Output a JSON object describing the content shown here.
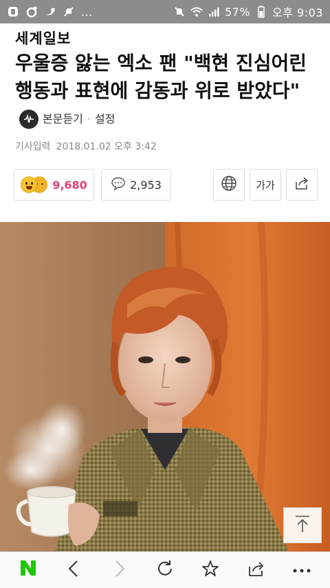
{
  "status_bar": {
    "ellipsis": "...",
    "battery_percent": "57%",
    "time": "오후 9:03"
  },
  "article": {
    "publisher": "세계일보",
    "title": "우울증 앓는 엑소 팬 \"백현 진심어린 행동과 표현에 감동과 위로 받았다\"",
    "listen_label": "본문듣기",
    "settings_label": "설정",
    "meta_label": "기사입력",
    "published_at": "2018.01.02 오후 3:42"
  },
  "actions": {
    "reaction_count": "9,680",
    "comment_count": "2,953",
    "font_label": "가가"
  },
  "colors": {
    "reaction_accent": "#e0407b",
    "naver_green": "#1ec800",
    "status_bar": "#8c8c8c"
  }
}
